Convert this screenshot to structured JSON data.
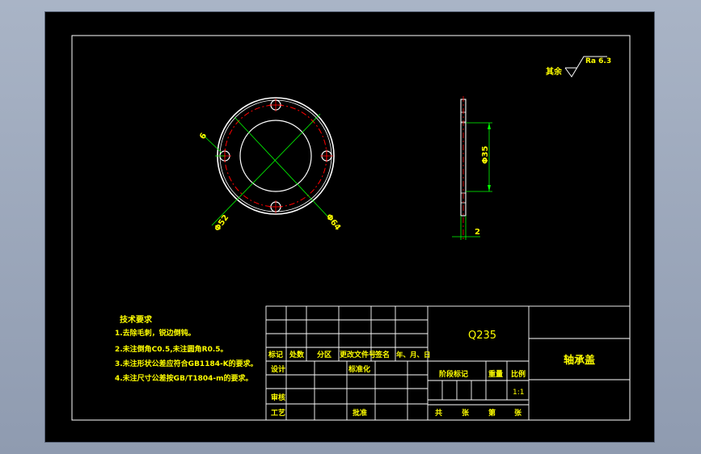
{
  "colors": {
    "background": "#000000",
    "frame": "#ffffff",
    "outline": "#ffffff",
    "center_line": "#ff0000",
    "dimension": "#00ff00",
    "text": "#ffff00"
  },
  "drawing": {
    "roughness": {
      "prefix": "其余",
      "value": "Ra 6.3"
    },
    "front_view": {
      "dims": {
        "hole": "6",
        "bolt_circle": "Φ52",
        "outer": "Φ64"
      }
    },
    "side_view": {
      "dims": {
        "diameter": "Φ35",
        "thickness": "2"
      }
    },
    "tech_requirements": {
      "title": "技术要求",
      "items": [
        "1.去除毛刺，锐边倒钝。",
        "2.未注倒角C0.5,未注圆角R0.5。",
        "3.未注形状公差应符合GB1184-K的要求。",
        "4.未注尺寸公差按GB/T1804-m的要求。"
      ]
    }
  },
  "title_block": {
    "material": "Q235",
    "part_name": "轴承盖",
    "scale": "1:1",
    "headers": {
      "mark": "标记",
      "count": "处数",
      "zone": "分区",
      "doc": "更改文件号",
      "sign": "签名",
      "date": "年、月、日"
    },
    "roles": {
      "design": "设计",
      "standard": "标准化",
      "review": "审核",
      "process": "工艺",
      "approve": "批准"
    },
    "stage_mark": "阶段标记",
    "weight": "重量",
    "ratio": "比例",
    "sheets": {
      "total": "共",
      "sheet": "张",
      "number": "第",
      "of": "张"
    }
  }
}
